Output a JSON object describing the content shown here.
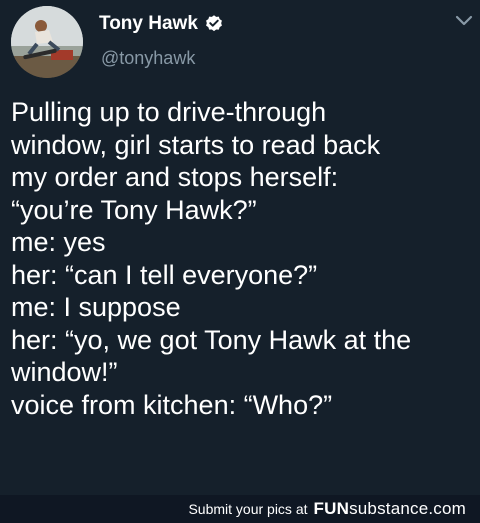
{
  "tweet": {
    "name": "Tony Hawk",
    "handle": "@tonyhawk",
    "lines": [
      "Pulling up to drive-through",
      "window, girl starts to read back",
      "my order and stops herself:",
      "“you’re Tony Hawk?”",
      "me: yes",
      "her: “can I tell everyone?”",
      "me: I suppose",
      "her: “yo, we got Tony Hawk at the",
      "window!”",
      "voice from kitchen: “Who?”"
    ]
  },
  "icons": {
    "verified": "verified-badge-icon",
    "caret": "chevron-down-icon",
    "avatar": "profile-photo"
  },
  "footer": {
    "submit_text": "Submit your pics at",
    "brand_bold": "FUN",
    "brand_rest": "substance.com"
  },
  "colors": {
    "background": "#15202b",
    "text": "#ffffff",
    "handle": "#8899a6",
    "footer_bg": "#0f1723"
  }
}
